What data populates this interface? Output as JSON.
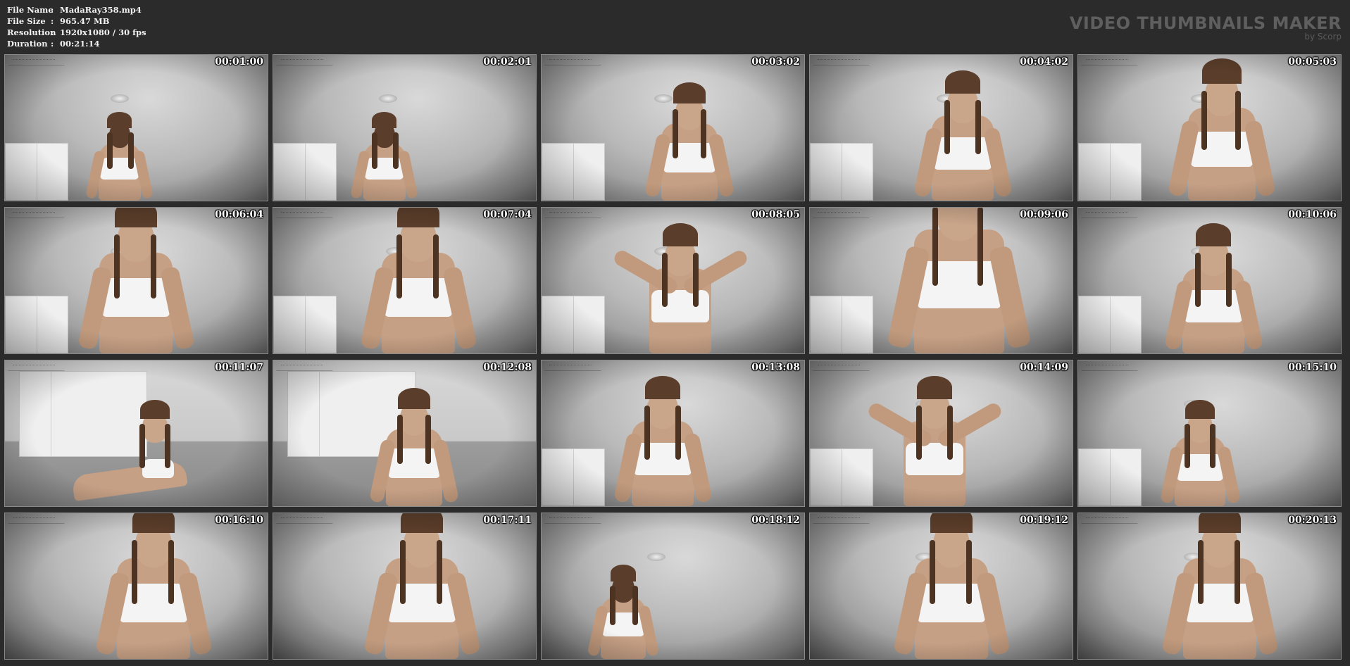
{
  "header": {
    "info": [
      {
        "key": "File Name",
        "value": "MadaRay358.mp4"
      },
      {
        "key": "File Size",
        "value": "965.47 MB"
      },
      {
        "key": "Resolution",
        "value": "1920x1080 / 30 fps"
      },
      {
        "key": "Duration",
        "value": "00:21:14"
      }
    ],
    "brand_title": "VIDEO THUMBNAILS MAKER",
    "brand_sub": "by Scorp"
  },
  "thumbnails": [
    {
      "time": "00:01:00"
    },
    {
      "time": "00:02:01"
    },
    {
      "time": "00:03:02"
    },
    {
      "time": "00:04:02"
    },
    {
      "time": "00:05:03"
    },
    {
      "time": "00:06:04"
    },
    {
      "time": "00:07:04"
    },
    {
      "time": "00:08:05"
    },
    {
      "time": "00:09:06"
    },
    {
      "time": "00:10:06"
    },
    {
      "time": "00:11:07"
    },
    {
      "time": "00:12:08"
    },
    {
      "time": "00:13:08"
    },
    {
      "time": "00:14:09"
    },
    {
      "time": "00:15:10"
    },
    {
      "time": "00:16:10"
    },
    {
      "time": "00:17:11"
    },
    {
      "time": "00:18:12"
    },
    {
      "time": "00:19:12"
    },
    {
      "time": "00:20:13"
    }
  ]
}
